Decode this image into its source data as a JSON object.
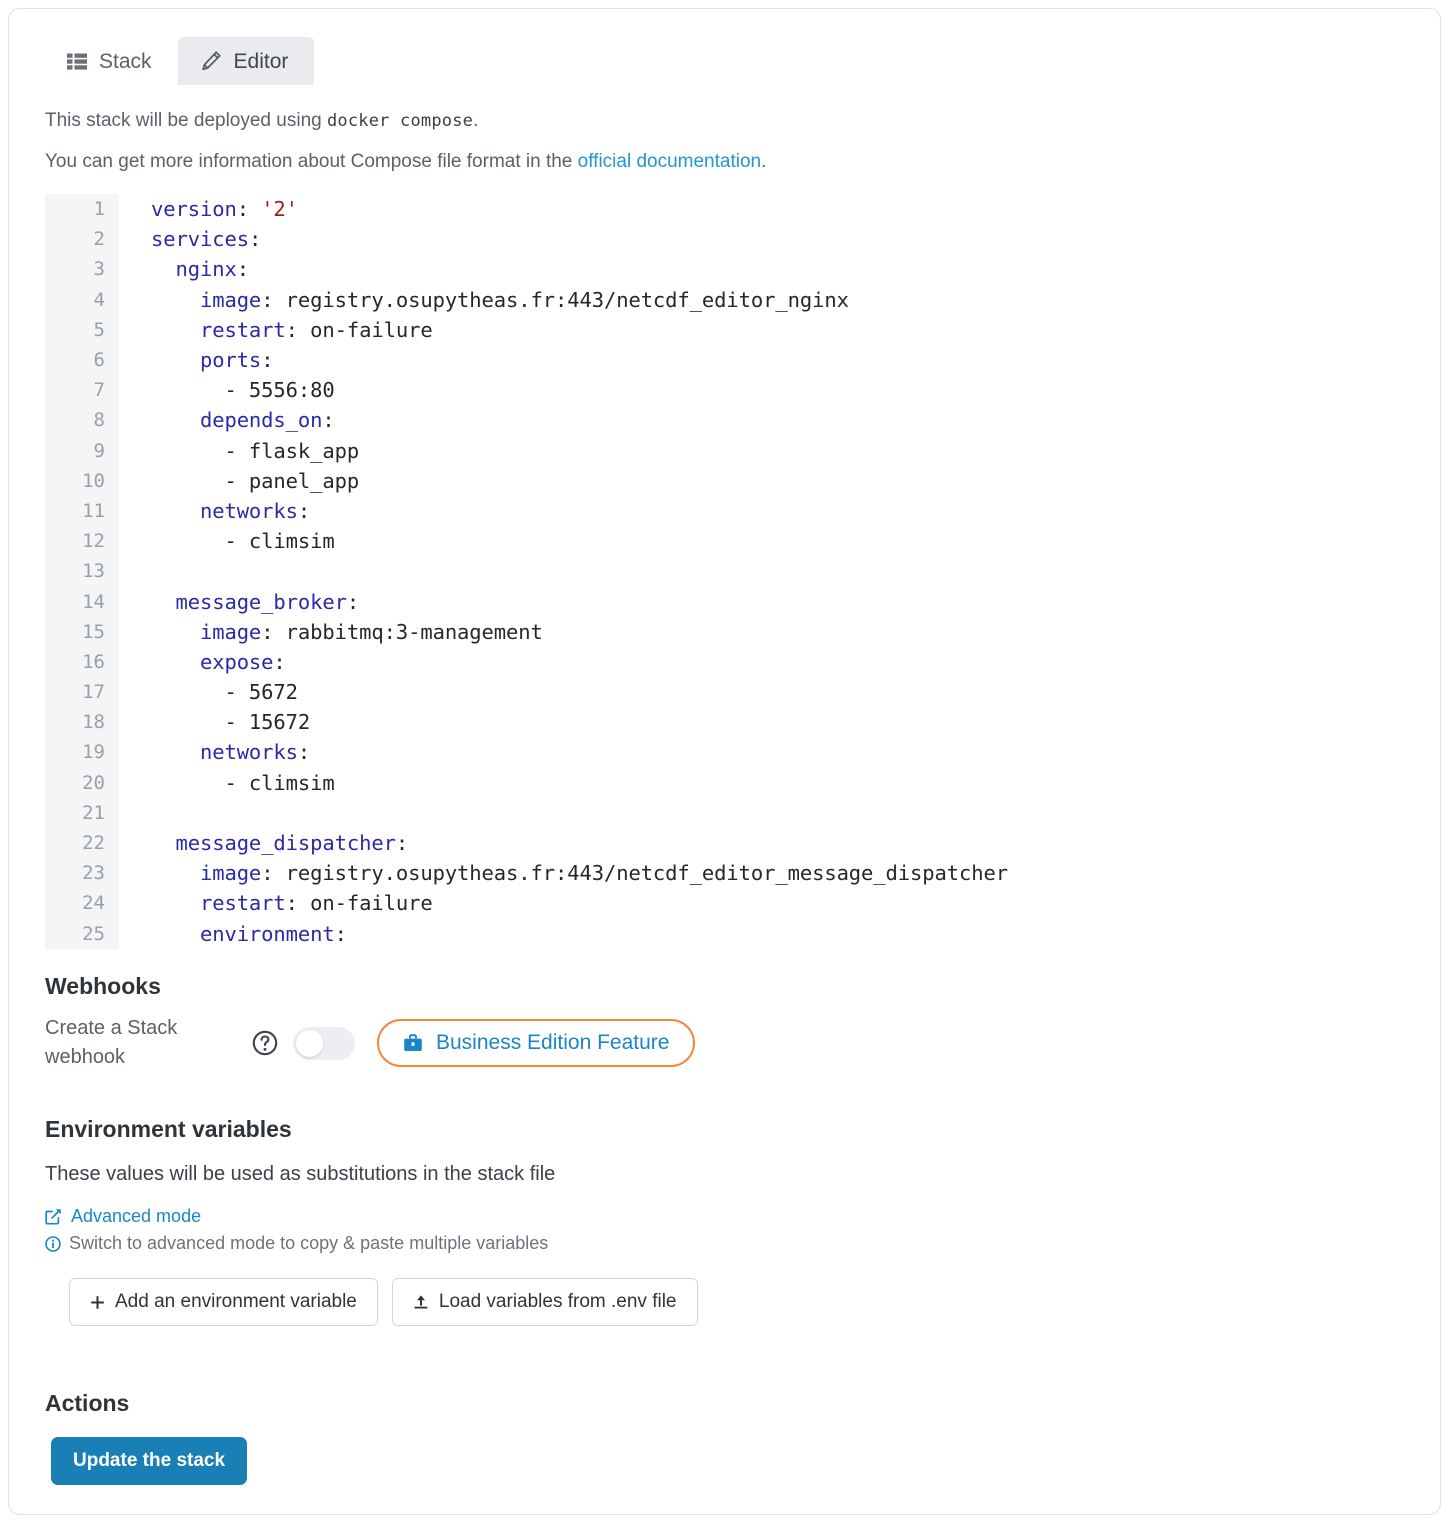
{
  "tabs": [
    {
      "label": "Stack",
      "icon": "list-icon",
      "active": false
    },
    {
      "label": "Editor",
      "icon": "pencil-icon",
      "active": true
    }
  ],
  "intro": {
    "line1_prefix": "This stack will be deployed using",
    "line1_code": "docker compose",
    "line1_suffix": ".",
    "line2_prefix": "You can get more information about Compose file format in the",
    "line2_link": "official documentation",
    "line2_suffix": "."
  },
  "editor": {
    "language": "yaml",
    "first_line": 1,
    "last_visible_line": 25,
    "lines": [
      {
        "n": "1",
        "segments": [
          {
            "t": "version",
            "c": "k"
          },
          {
            "t": ": ",
            "c": ""
          },
          {
            "t": "'2'",
            "c": "str"
          }
        ]
      },
      {
        "n": "2",
        "segments": [
          {
            "t": "services",
            "c": "k"
          },
          {
            "t": ":",
            "c": ""
          }
        ]
      },
      {
        "n": "3",
        "segments": [
          {
            "t": "  ",
            "c": ""
          },
          {
            "t": "nginx",
            "c": "srv"
          },
          {
            "t": ":",
            "c": ""
          }
        ]
      },
      {
        "n": "4",
        "segments": [
          {
            "t": "    ",
            "c": ""
          },
          {
            "t": "image",
            "c": "k"
          },
          {
            "t": ": registry.osupytheas.fr:443/netcdf_editor_nginx",
            "c": ""
          }
        ]
      },
      {
        "n": "5",
        "segments": [
          {
            "t": "    ",
            "c": ""
          },
          {
            "t": "restart",
            "c": "k"
          },
          {
            "t": ": on-failure",
            "c": ""
          }
        ]
      },
      {
        "n": "6",
        "segments": [
          {
            "t": "    ",
            "c": ""
          },
          {
            "t": "ports",
            "c": "k"
          },
          {
            "t": ":",
            "c": ""
          }
        ]
      },
      {
        "n": "7",
        "segments": [
          {
            "t": "      - 5556:80",
            "c": ""
          }
        ]
      },
      {
        "n": "8",
        "segments": [
          {
            "t": "    ",
            "c": ""
          },
          {
            "t": "depends_on",
            "c": "k"
          },
          {
            "t": ":",
            "c": ""
          }
        ]
      },
      {
        "n": "9",
        "segments": [
          {
            "t": "      - flask_app",
            "c": ""
          }
        ]
      },
      {
        "n": "10",
        "segments": [
          {
            "t": "      - panel_app",
            "c": ""
          }
        ]
      },
      {
        "n": "11",
        "segments": [
          {
            "t": "    ",
            "c": ""
          },
          {
            "t": "networks",
            "c": "k"
          },
          {
            "t": ":",
            "c": ""
          }
        ]
      },
      {
        "n": "12",
        "segments": [
          {
            "t": "      - climsim",
            "c": ""
          }
        ]
      },
      {
        "n": "13",
        "segments": [
          {
            "t": "",
            "c": ""
          }
        ]
      },
      {
        "n": "14",
        "segments": [
          {
            "t": "  ",
            "c": ""
          },
          {
            "t": "message_broker",
            "c": "srv"
          },
          {
            "t": ":",
            "c": ""
          }
        ]
      },
      {
        "n": "15",
        "segments": [
          {
            "t": "    ",
            "c": ""
          },
          {
            "t": "image",
            "c": "k"
          },
          {
            "t": ": rabbitmq:3-management",
            "c": ""
          }
        ]
      },
      {
        "n": "16",
        "segments": [
          {
            "t": "    ",
            "c": ""
          },
          {
            "t": "expose",
            "c": "k"
          },
          {
            "t": ":",
            "c": ""
          }
        ]
      },
      {
        "n": "17",
        "segments": [
          {
            "t": "      - 5672",
            "c": ""
          }
        ]
      },
      {
        "n": "18",
        "segments": [
          {
            "t": "      - 15672",
            "c": ""
          }
        ]
      },
      {
        "n": "19",
        "segments": [
          {
            "t": "    ",
            "c": ""
          },
          {
            "t": "networks",
            "c": "k"
          },
          {
            "t": ":",
            "c": ""
          }
        ]
      },
      {
        "n": "20",
        "segments": [
          {
            "t": "      - climsim",
            "c": ""
          }
        ]
      },
      {
        "n": "21",
        "segments": [
          {
            "t": "",
            "c": ""
          }
        ]
      },
      {
        "n": "22",
        "segments": [
          {
            "t": "  ",
            "c": ""
          },
          {
            "t": "message_dispatcher",
            "c": "srv"
          },
          {
            "t": ":",
            "c": ""
          }
        ]
      },
      {
        "n": "23",
        "segments": [
          {
            "t": "    ",
            "c": ""
          },
          {
            "t": "image",
            "c": "k"
          },
          {
            "t": ": registry.osupytheas.fr:443/netcdf_editor_message_dispatcher",
            "c": ""
          }
        ]
      },
      {
        "n": "24",
        "segments": [
          {
            "t": "    ",
            "c": ""
          },
          {
            "t": "restart",
            "c": "k"
          },
          {
            "t": ": on-failure",
            "c": ""
          }
        ]
      },
      {
        "n": "25",
        "segments": [
          {
            "t": "    ",
            "c": ""
          },
          {
            "t": "environment",
            "c": "k"
          },
          {
            "t": ":",
            "c": ""
          }
        ]
      }
    ]
  },
  "webhooks": {
    "heading": "Webhooks",
    "create_label": "Create a Stack webhook",
    "toggle_state": "off",
    "badge_label": "Business Edition Feature",
    "badge_icon": "briefcase-icon",
    "help_icon": "question-circle-icon"
  },
  "env": {
    "heading": "Environment variables",
    "description": "These values will be used as substitutions in the stack file",
    "advanced_label": "Advanced mode",
    "advanced_icon": "edit-square-icon",
    "hint": "Switch to advanced mode to copy & paste multiple variables",
    "hint_icon": "info-circle-icon",
    "add_button": "Add an environment variable",
    "add_button_icon": "plus-icon",
    "load_button": "Load variables from .env file",
    "load_button_icon": "upload-icon"
  },
  "actions": {
    "heading": "Actions",
    "update_button": "Update the stack"
  },
  "colors": {
    "accent_blue": "#1a7fb5",
    "link_blue": "#2196cf",
    "badge_border_orange": "#f0883a",
    "yaml_key": "#2a2aa5",
    "yaml_string": "#9b1c1c",
    "gutter_bg": "#f4f5f6"
  }
}
